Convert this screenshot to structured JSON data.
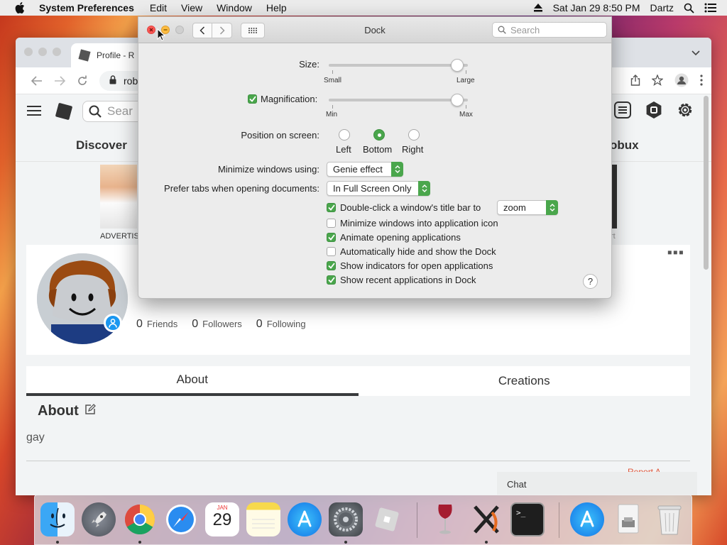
{
  "menubar": {
    "app_name": "System Preferences",
    "items": [
      "Edit",
      "View",
      "Window",
      "Help"
    ],
    "clock": "Sat Jan 29  8:50 PM",
    "user": "Dartz"
  },
  "browser": {
    "tab_title": "Profile - R",
    "url": "roblc",
    "search_placeholder": "Sear",
    "nav": {
      "discover": "Discover",
      "robux": "obux"
    },
    "ad_label_left": "ADVERTISE",
    "ad_label_right": "rt",
    "friends": {
      "count": "0",
      "label": "Friends"
    },
    "followers": {
      "count": "0",
      "label": "Followers"
    },
    "following": {
      "count": "0",
      "label": "Following"
    },
    "tabs": {
      "about": "About",
      "creations": "Creations"
    },
    "about_heading": "About",
    "about_text": "gay",
    "chat": "Chat",
    "partial_red": "Report A..."
  },
  "prefs": {
    "title": "Dock",
    "search_placeholder": "Search",
    "size": {
      "label": "Size:",
      "min": "Small",
      "max": "Large",
      "value_fraction": 1.0
    },
    "magnification": {
      "label": "Magnification:",
      "checked": true,
      "min": "Min",
      "max": "Max",
      "value_fraction": 1.0
    },
    "position": {
      "label": "Position on screen:",
      "options": [
        "Left",
        "Bottom",
        "Right"
      ],
      "selected": "Bottom"
    },
    "minimize": {
      "label": "Minimize windows using:",
      "value": "Genie effect"
    },
    "prefer_tabs": {
      "label": "Prefer tabs when opening documents:",
      "value": "In Full Screen Only"
    },
    "double_click": {
      "label": "Double-click a window's title bar to",
      "value": "zoom",
      "checked": true
    },
    "checkboxes": [
      {
        "label": "Minimize windows into application icon",
        "checked": false
      },
      {
        "label": "Animate opening applications",
        "checked": true
      },
      {
        "label": "Automatically hide and show the Dock",
        "checked": false
      },
      {
        "label": "Show indicators for open applications",
        "checked": true
      },
      {
        "label": "Show recent applications in Dock",
        "checked": true
      }
    ],
    "help": "?"
  },
  "dock": {
    "apps": [
      "Finder",
      "Launchpad",
      "Google Chrome",
      "Safari",
      "Calendar",
      "Notes",
      "App Store",
      "System Preferences",
      "Roblox",
      "Wine",
      "X11",
      "Terminal",
      "App Store Recent",
      "Downloads",
      "Trash"
    ],
    "calendar_month": "JAN",
    "calendar_day": "29"
  },
  "colors": {
    "accent": "#4aa64c",
    "close": "#fc5753",
    "minimize": "#fdbc40"
  }
}
